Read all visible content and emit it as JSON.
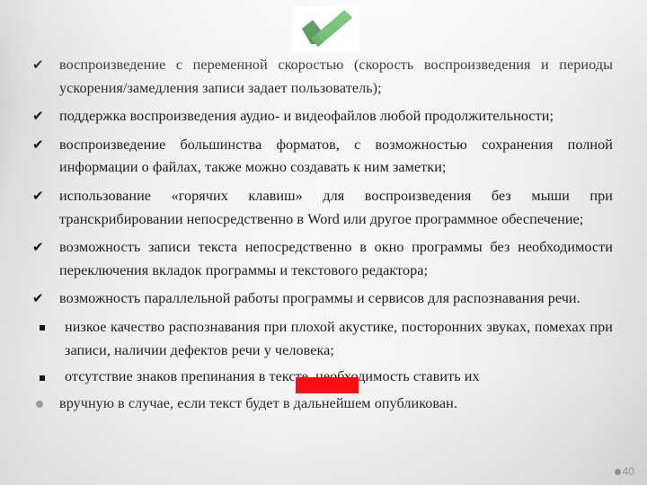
{
  "slide": {
    "page_number": "40",
    "background_accent": "#f2f2f2"
  },
  "check_image": {
    "name": "green-check-mark",
    "colors": {
      "light_green": "#4caf50",
      "dark_green": "#2e7d32",
      "plate": "#ffffff"
    }
  },
  "redaction": {
    "color": "#fc0b10",
    "label": ""
  },
  "bullets": [
    {
      "marker": "✔",
      "text": "воспроизведение с переменной скоростью (скорость воспроизведения и периоды ускорения/замедления записи задает пользователь);"
    },
    {
      "marker": "✔",
      "text": "поддержка воспроизведения аудио- и видеофайлов любой продолжительности;"
    },
    {
      "marker": "✔",
      "text": "воспроизведение большинства форматов, с возможностью сохранения полной информации о файлах, также можно создавать к ним заметки;"
    },
    {
      "marker": "✔",
      "text": "использование «горячих клавиш» для воспроизведения без мыши при транскрибировании непосредственно в Word или другое программное обеспечение;"
    },
    {
      "marker": "✔",
      "text": "возможность записи текста непосредственно в окно программы без необходимости переключения вкладок программы и текстового редактора;"
    },
    {
      "marker": "✔",
      "text": "возможность параллельной работы программы и сервисов для распознавания речи."
    }
  ],
  "sub_bullets": [
    {
      "marker": "▪",
      "text": "низкое качество распознавания при плохой акустике, посторонних звуках, помехах при записи, наличии дефектов речи у человека;"
    },
    {
      "marker": "▪",
      "text": "отсутствие знаков препинания в тексте, необходимость ставить их"
    }
  ],
  "final_line": {
    "marker": "●",
    "text": "вручную в случае, если текст будет в дальнейшем опубликован."
  }
}
